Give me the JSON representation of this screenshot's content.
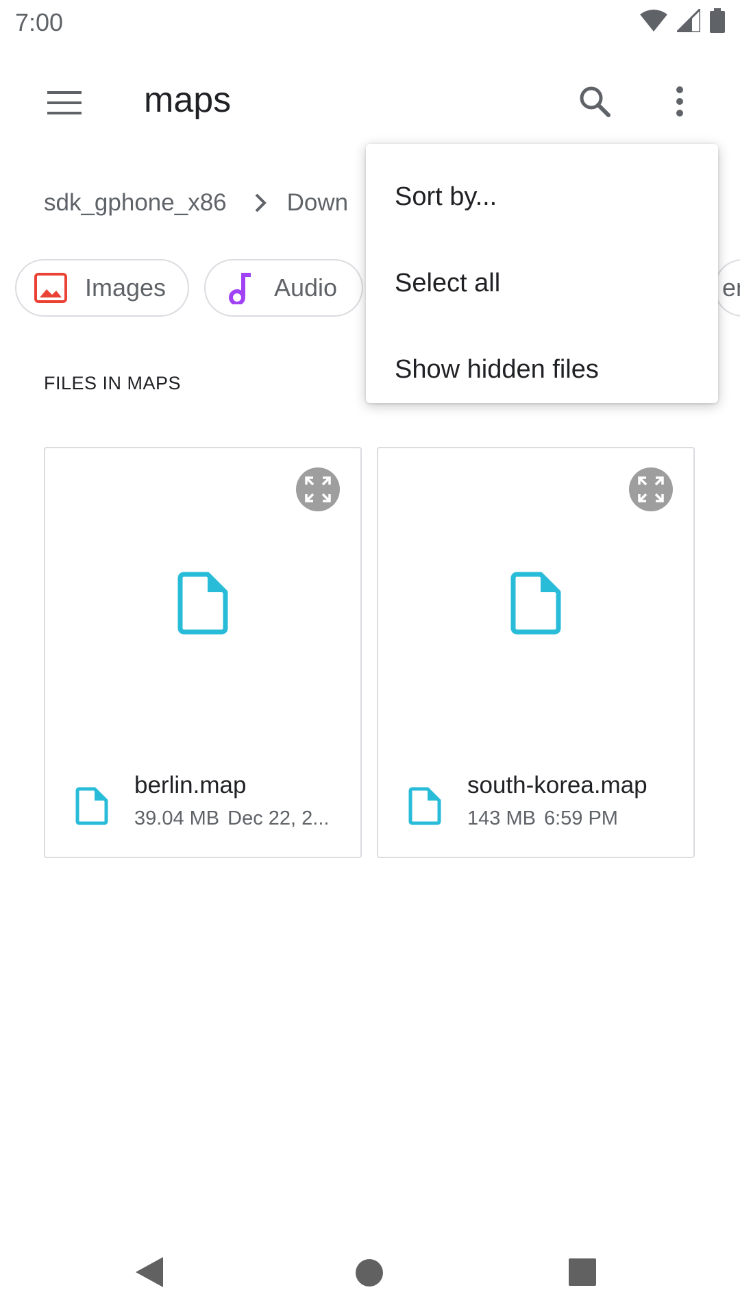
{
  "status_bar": {
    "time": "7:00"
  },
  "app_bar": {
    "title": "maps"
  },
  "breadcrumb": {
    "root": "sdk_gphone_x86",
    "current": "Down"
  },
  "chips": [
    {
      "label": "Images",
      "icon": "image-icon",
      "color": "#ea4335"
    },
    {
      "label": "Audio",
      "icon": "music-note-icon",
      "color": "#a142f4"
    },
    {
      "label": "ents",
      "icon": "document-icon"
    }
  ],
  "section_header": "FILES IN MAPS",
  "files": [
    {
      "name": "berlin.map",
      "size": "39.04 MB",
      "date": "Dec 22, 2..."
    },
    {
      "name": "south-korea.map",
      "size": "143 MB",
      "date": "6:59 PM"
    }
  ],
  "overflow_menu": {
    "items": [
      "Sort by...",
      "Select all",
      "Show hidden files"
    ]
  },
  "colors": {
    "file_icon": "#29bcd8",
    "text_primary": "#202124",
    "text_secondary": "#5f6368",
    "outline": "#dadce0"
  }
}
